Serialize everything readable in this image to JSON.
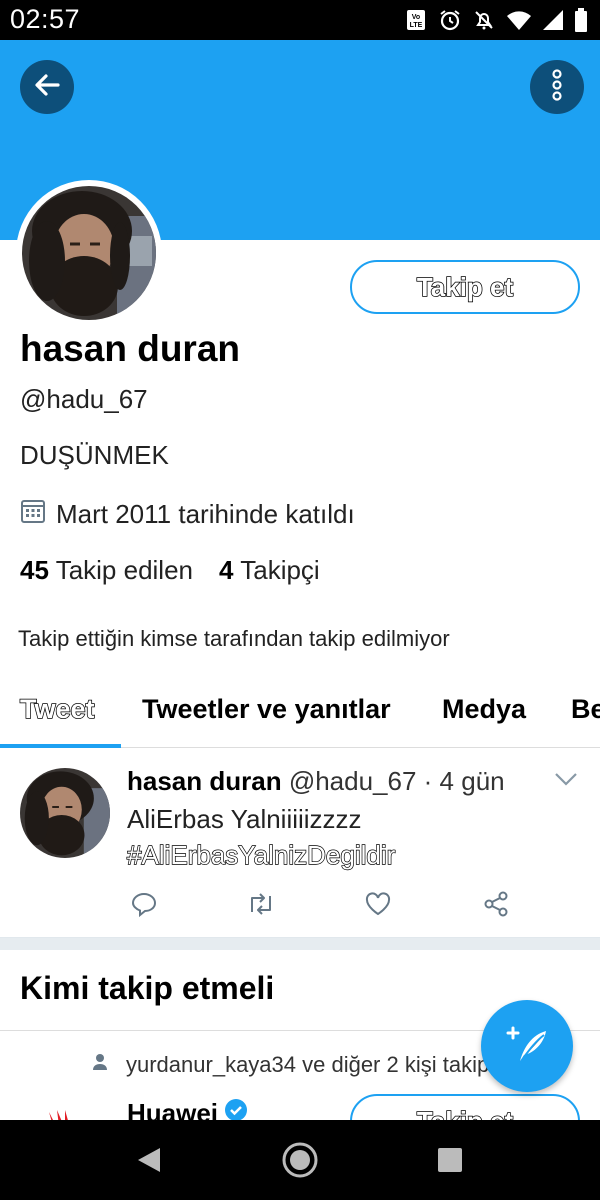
{
  "status_bar": {
    "time": "02:57",
    "icons": [
      "volte-icon",
      "alarm-icon",
      "mute-icon",
      "wifi-icon",
      "signal-icon",
      "battery-icon"
    ]
  },
  "header": {
    "back_icon": "arrow-left-icon",
    "more_icon": "more-vertical-icon",
    "banner_color": "#1da1f2"
  },
  "profile": {
    "follow_label": "Takip et",
    "name": "hasan duran",
    "handle": "@hadu_67",
    "bio": "DUŞÜNMEK",
    "joined": "Mart 2011 tarihinde katıldı",
    "following_count": "45",
    "following_label": "Takip edilen",
    "followers_count": "4",
    "followers_label": "Takipçi",
    "notice": "Takip ettiğin kimse tarafından takip edilmiyor"
  },
  "tabs": [
    {
      "label": "Tweet",
      "active": true
    },
    {
      "label": "Tweetler ve yanıtlar",
      "active": false
    },
    {
      "label": "Medya",
      "active": false
    },
    {
      "label": "Be",
      "active": false
    }
  ],
  "tweet": {
    "name": "hasan duran",
    "meta": "@hadu_67 · 4 gün",
    "text": "AliErbas Yalniiiiizzzz",
    "hashtag": "#AliErbasYalnizDegildir",
    "actions": [
      "reply-icon",
      "retweet-icon",
      "like-icon",
      "share-icon"
    ]
  },
  "who_to_follow": {
    "title": "Kimi takip etmeli",
    "context": "yurdanur_kaya34 ve diğer 2 kişi takip ediyor",
    "suggestion_name": "Huawei",
    "suggestion_follow_label": "Takip et"
  },
  "colors": {
    "accent": "#1da1f2",
    "header_button": "#0d4f7a"
  }
}
